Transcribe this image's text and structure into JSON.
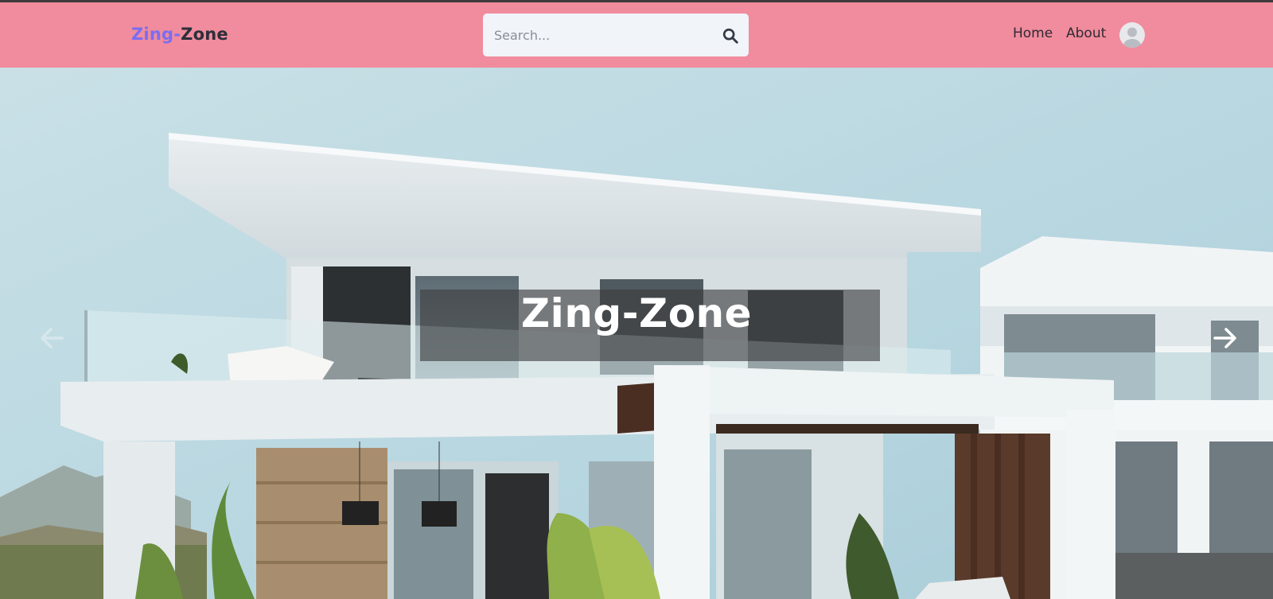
{
  "navbar": {
    "logo_part1": "Zing",
    "logo_part2": "-",
    "logo_part3": "Zone",
    "search": {
      "placeholder": "Search..."
    },
    "links": {
      "home": "Home",
      "about": "About"
    }
  },
  "hero": {
    "caption": "Zing-Zone"
  },
  "colors": {
    "navbar_bg": "#f08c9d",
    "logo_accent": "#7b6df0",
    "logo_dark": "#2c2f3a",
    "search_bg": "#f1f4f9"
  },
  "icons": {
    "search": "search-icon",
    "avatar": "user-avatar-icon",
    "prev": "arrow-left-icon",
    "next": "arrow-right-icon"
  }
}
